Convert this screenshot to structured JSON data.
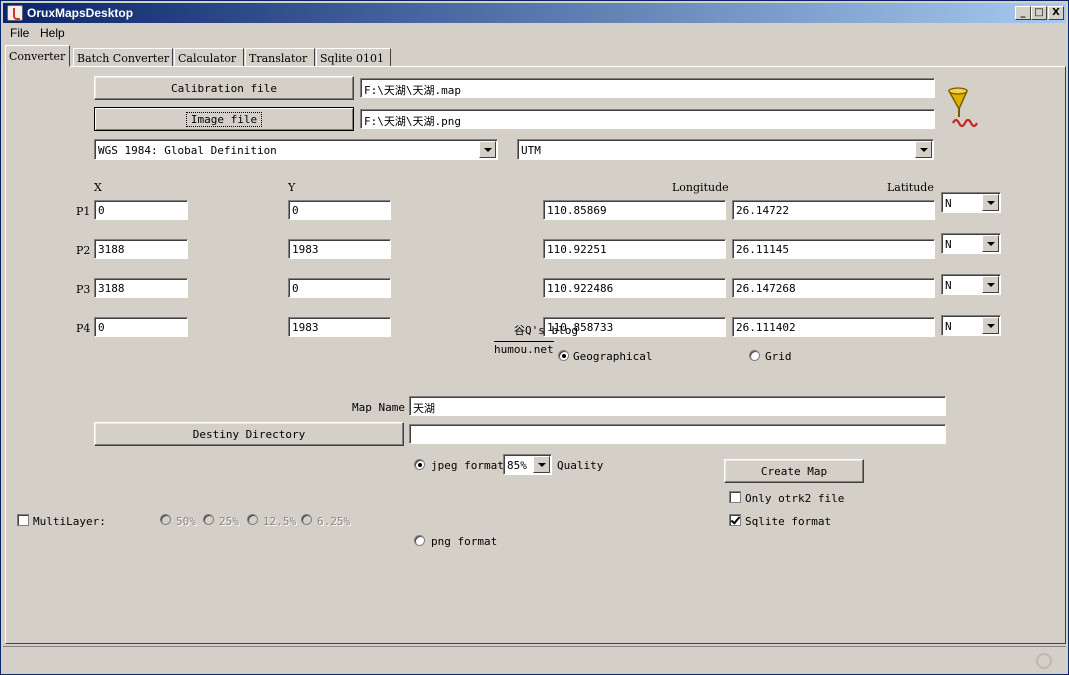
{
  "window": {
    "title": "OruxMapsDesktop",
    "minimize": "_",
    "maximize": "□",
    "close": "X"
  },
  "menu": {
    "file": "File",
    "help": "Help"
  },
  "tabs": [
    "Converter",
    "Batch Converter",
    "Calculator",
    "Translator",
    "Sqlite 0101"
  ],
  "files": {
    "calibration_label": "Calibration file",
    "calibration_value": "F:\\天湖\\天湖.map",
    "image_label": "Image file",
    "image_value": "F:\\天湖\\天湖.png"
  },
  "datum": {
    "selected": "WGS 1984: Global Definition"
  },
  "projection": {
    "selected": "UTM"
  },
  "columns": {
    "x": "X",
    "y": "Y",
    "longitude": "Longitude",
    "latitude": "Latitude"
  },
  "points": [
    {
      "label": "P1",
      "x": "0",
      "y": "0",
      "lon": "110.85869",
      "lat": "26.14722",
      "hemi": "N"
    },
    {
      "label": "P2",
      "x": "3188",
      "y": "1983",
      "lon": "110.92251",
      "lat": "26.11145",
      "hemi": "N"
    },
    {
      "label": "P3",
      "x": "3188",
      "y": "0",
      "lon": "110.922486",
      "lat": "26.147268",
      "hemi": "N"
    },
    {
      "label": "P4",
      "x": "0",
      "y": "1983",
      "lon": "110.858733",
      "lat": "26.111402",
      "hemi": "N"
    }
  ],
  "coord_mode": {
    "geographical": "Geographical",
    "grid": "Grid",
    "selected": "geographical"
  },
  "watermark": {
    "line1": "谷Q's blog",
    "line2": "humou.net"
  },
  "map": {
    "name_label": "Map Name",
    "name_value": "天湖",
    "destiny_label": "Destiny Directory",
    "destiny_value": ""
  },
  "format": {
    "jpeg_label": "jpeg format",
    "quality_value": "85%",
    "quality_label": "Quality",
    "png_label": "png format",
    "selected": "jpeg"
  },
  "create": {
    "button_label": "Create Map",
    "only_otrk2_label": "Only otrk2 file",
    "only_otrk2_checked": false,
    "sqlite_label": "Sqlite format",
    "sqlite_checked": true
  },
  "multilayer": {
    "label": "MultiLayer:",
    "checked": false,
    "levels": [
      "50%",
      "25%",
      "12.5%",
      "6.25%"
    ]
  }
}
